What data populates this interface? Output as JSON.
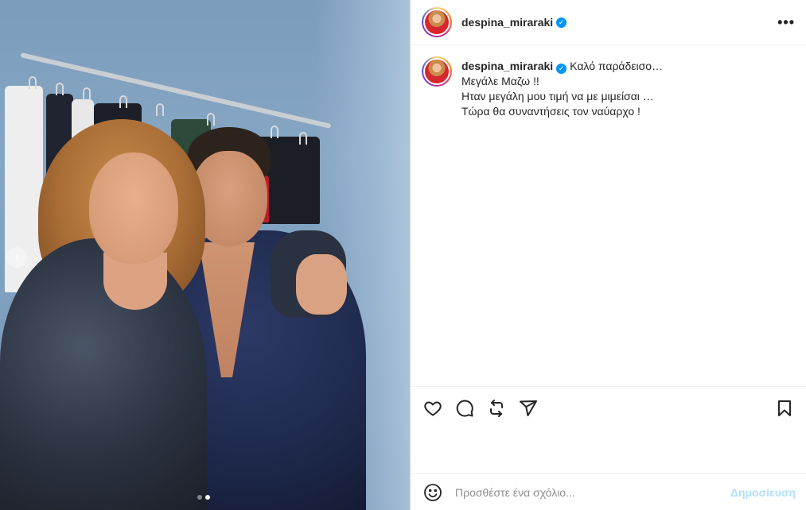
{
  "post": {
    "username": "despina_miraraki",
    "verified_symbol": "✓",
    "more_symbol": "•••",
    "carousel": {
      "current_index": 2,
      "total": 2,
      "arrow_symbol": "‹"
    },
    "caption": {
      "first_line": "Καλό παράδεισο…",
      "lines": [
        "Μεγάλε Μαζω !!",
        "Ηταν μεγάλη μου τιμή να με μιμείσαι …",
        "Τώρα θα συναντήσεις τον ναύαρχο !"
      ]
    }
  },
  "actions": {
    "icons": [
      "heart-icon",
      "comment-icon",
      "repost-icon",
      "share-icon",
      "bookmark-icon"
    ]
  },
  "comment_box": {
    "placeholder": "Προσθέστε ένα σχόλιο...",
    "post_label": "Δημοσίευση",
    "emoji_icon": "smiley-icon"
  },
  "colors": {
    "verified": "#0095f6",
    "post_button": "#b2dffc",
    "text": "#262626",
    "muted": "#8e8e8e"
  }
}
